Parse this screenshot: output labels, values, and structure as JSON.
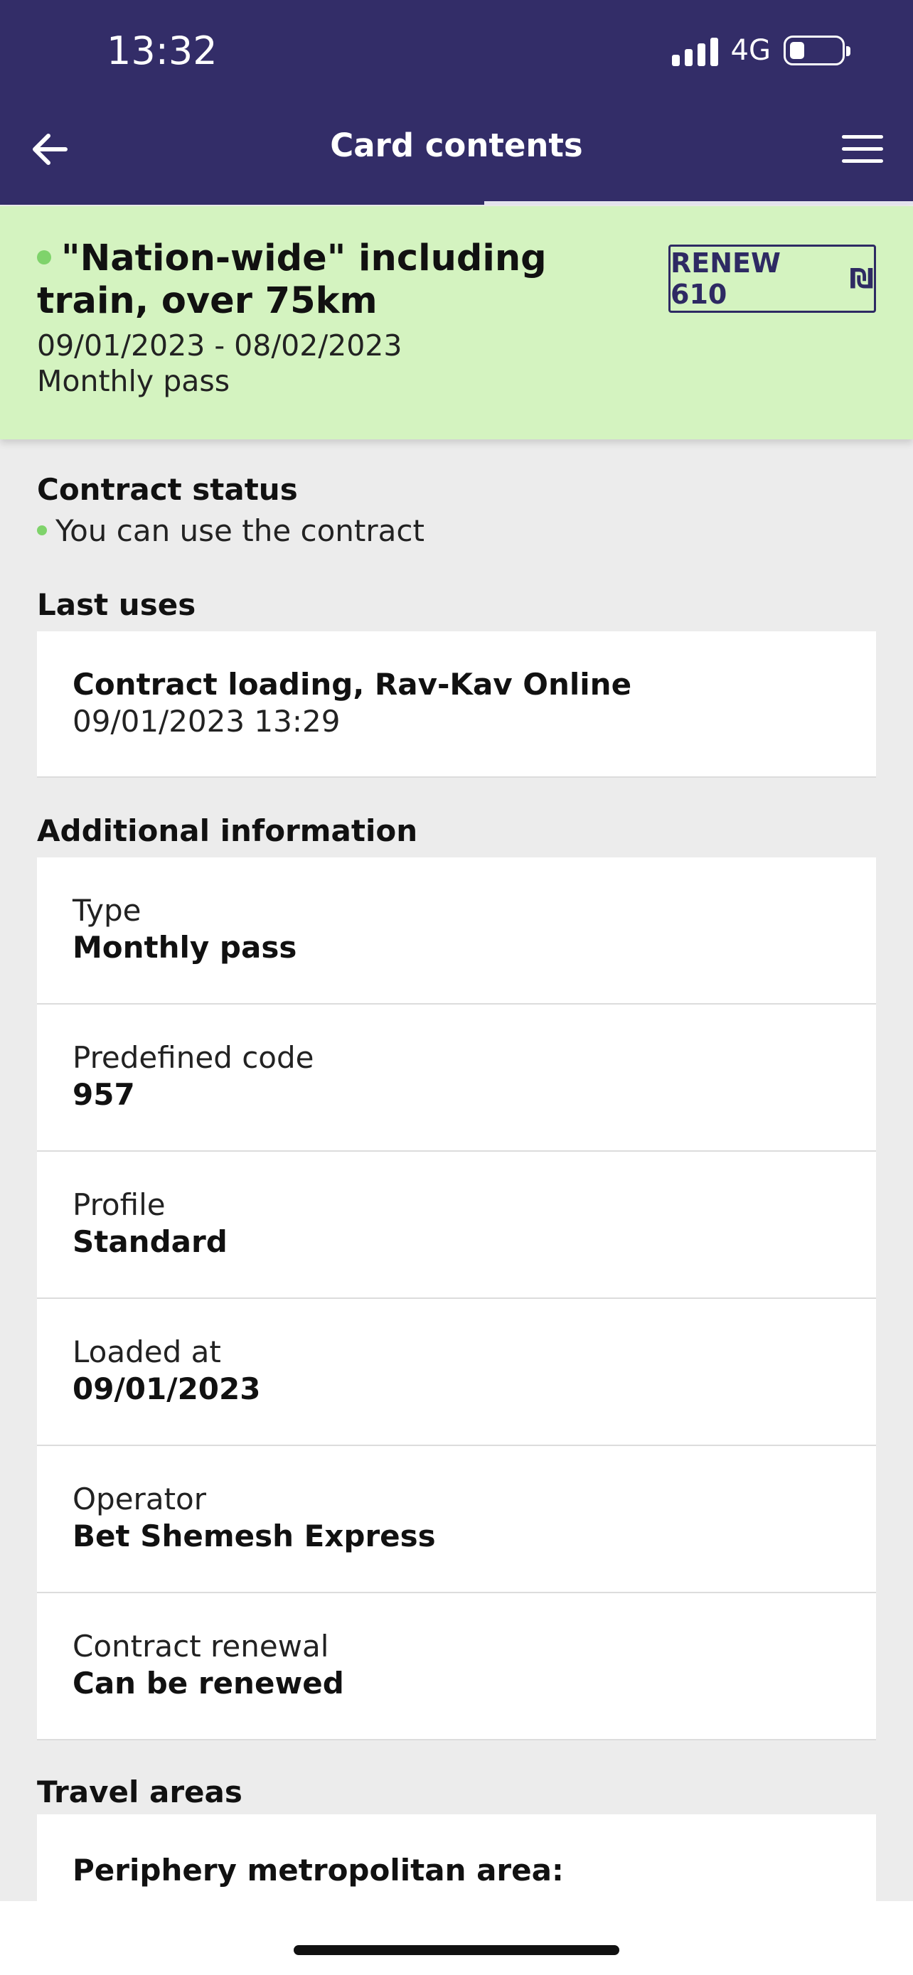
{
  "status_bar": {
    "time": "13:32",
    "network": "4G",
    "battery_level": 0.3
  },
  "header": {
    "title": "Card contents",
    "back_icon": "arrow-left-icon",
    "menu_icon": "hamburger-menu-icon",
    "progress": 0.53
  },
  "contract": {
    "title": "\"Nation-wide\" including train, over 75km",
    "dates": "09/01/2023 - 08/02/2023",
    "type": "Monthly pass",
    "renew_label": "RENEW 610",
    "currency_symbol": "₪",
    "status_color": "#7fd36b"
  },
  "contract_status": {
    "heading": "Contract status",
    "text": "You can use the contract"
  },
  "last_uses": {
    "heading": "Last uses",
    "items": [
      {
        "title": "Contract loading, Rav-Kav Online",
        "datetime": "09/01/2023 13:29"
      }
    ]
  },
  "additional_information": {
    "heading": "Additional information",
    "rows": [
      {
        "label": "Type",
        "value": "Monthly pass"
      },
      {
        "label": "Predefined code",
        "value": "957"
      },
      {
        "label": "Profile",
        "value": "Standard"
      },
      {
        "label": "Loaded at",
        "value": "09/01/2023"
      },
      {
        "label": "Operator",
        "value": "Bet Shemesh Express"
      },
      {
        "label": "Contract renewal",
        "value": "Can be renewed"
      }
    ]
  },
  "travel_areas": {
    "heading": "Travel areas",
    "first_item": "Periphery metropolitan area:"
  },
  "colors": {
    "header_bg": "#332d68",
    "banner_bg": "#d4f3c0",
    "page_bg": "#ececec"
  }
}
